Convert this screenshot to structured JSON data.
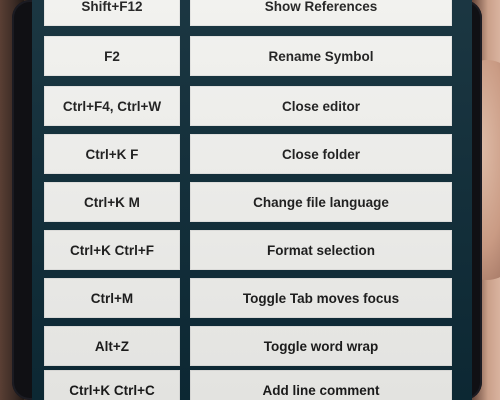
{
  "shortcuts": [
    {
      "keys": "Shift+F12",
      "action": "Show References"
    },
    {
      "keys": "F2",
      "action": "Rename Symbol"
    },
    {
      "keys": "Ctrl+F4, Ctrl+W",
      "action": "Close editor"
    },
    {
      "keys": "Ctrl+K F",
      "action": "Close folder"
    },
    {
      "keys": "Ctrl+K M",
      "action": "Change file language"
    },
    {
      "keys": "Ctrl+K Ctrl+F",
      "action": "Format selection"
    },
    {
      "keys": "Ctrl+M",
      "action": "Toggle Tab moves focus"
    },
    {
      "keys": "Alt+Z",
      "action": "Toggle word wrap"
    },
    {
      "keys": "Ctrl+K Ctrl+C",
      "action": "Add line comment"
    }
  ]
}
